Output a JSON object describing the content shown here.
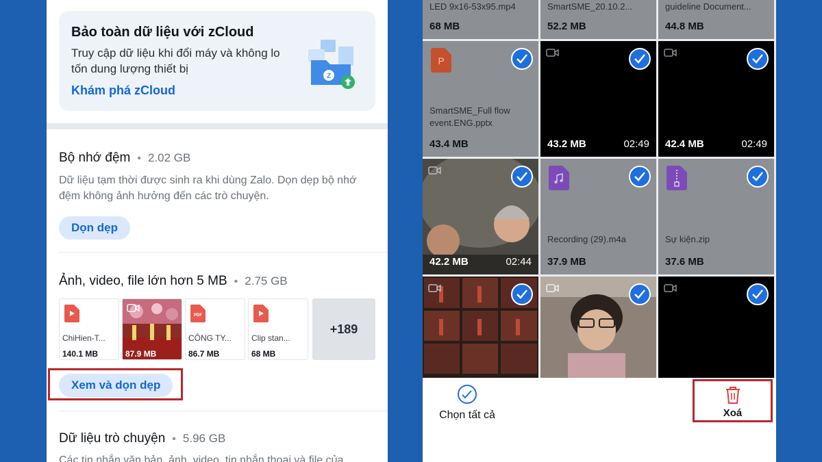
{
  "promo": {
    "title": "Bảo toàn dữ liệu với zCloud",
    "desc": "Truy cập dữ liệu khi đổi máy và không lo tốn dung lượng thiết bị",
    "link": "Khám phá zCloud"
  },
  "cache": {
    "title": "Bộ nhớ đệm",
    "size": "2.02 GB",
    "desc": "Dữ liệu tạm thời được sinh ra khi dùng Zalo. Dọn dẹp bộ nhớ đệm không ảnh hưởng đến các trò chuyện.",
    "button": "Dọn dẹp"
  },
  "large_files": {
    "title": "Ảnh, video, file lớn hơn 5 MB",
    "size": "2.75 GB",
    "tiles": [
      {
        "name": "ChiHien-T...",
        "size": "140.1 MB",
        "type": "video"
      },
      {
        "name": "",
        "size": "87.9 MB",
        "type": "photo"
      },
      {
        "name": "CÔNG TY...",
        "size": "86.7 MB",
        "type": "pdf"
      },
      {
        "name": "Clip stan...",
        "size": "68 MB",
        "type": "video"
      }
    ],
    "more": "+189",
    "button": "Xem và dọn dẹp"
  },
  "chat_data": {
    "title": "Dữ liệu trò chuyện",
    "size": "5.96 GB",
    "desc": "Các tin nhắn văn bản, ảnh, video, tin nhắn thoại và file của"
  },
  "grid": {
    "top_row": [
      {
        "name": "LED 9x16-53x95.mp4",
        "size": "68 MB"
      },
      {
        "name": "SmartSME_20.10.2...",
        "size": "52.2 MB"
      },
      {
        "name": "guideline Document...",
        "size": "44.8 MB"
      }
    ],
    "row2": [
      {
        "name": "SmartSME_Full flow event.ENG.pptx",
        "size": "43.4 MB",
        "kind": "pptx"
      },
      {
        "name": "",
        "size": "43.2 MB",
        "duration": "02:49",
        "kind": "video"
      },
      {
        "name": "",
        "size": "42.4 MB",
        "duration": "02:49",
        "kind": "video"
      }
    ],
    "row3": [
      {
        "name": "",
        "size": "42.2 MB",
        "duration": "02:44",
        "kind": "video-photo"
      },
      {
        "name": "Recording (29).m4a",
        "size": "37.9 MB",
        "kind": "audio"
      },
      {
        "name": "Sự kiện.zip",
        "size": "37.6 MB",
        "kind": "zip"
      }
    ]
  },
  "bottom": {
    "select_all": "Chọn tất cả",
    "delete": "Xoá"
  },
  "colors": {
    "brand_blue": "#1f6fde",
    "highlight_red": "#b8272b",
    "background": "#1d5fb0"
  }
}
